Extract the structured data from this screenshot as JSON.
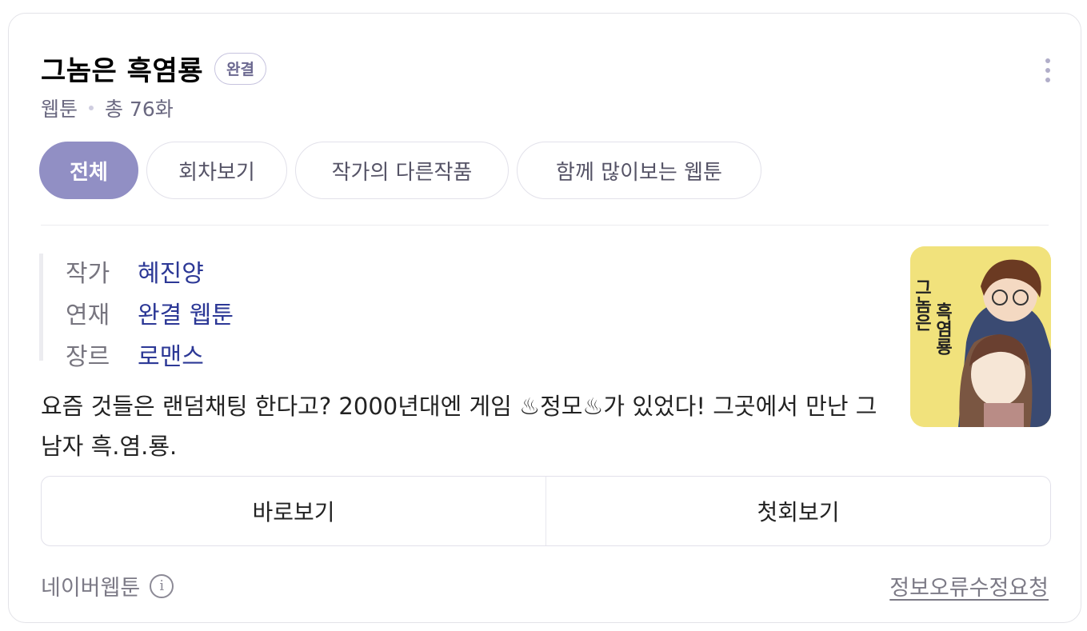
{
  "header": {
    "title": "그놈은 흑염룡",
    "status_badge": "완결",
    "meta_type": "웹툰",
    "meta_count": "총 76화"
  },
  "tabs": [
    {
      "label": "전체",
      "active": true
    },
    {
      "label": "회차보기",
      "active": false
    },
    {
      "label": "작가의 다른작품",
      "active": false
    },
    {
      "label": "함께 많이보는 웹툰",
      "active": false
    }
  ],
  "info": [
    {
      "label": "작가",
      "value": "혜진양"
    },
    {
      "label": "연재",
      "value": "완결 웹툰"
    },
    {
      "label": "장르",
      "value": "로맨스"
    }
  ],
  "synopsis": "요즘 것들은 랜덤채팅 한다고? 2000년대엔 게임 ♨정모♨가 있었다! 그곳에서 만난 그 남자 흑.염.룡.",
  "thumbnail": {
    "cover_text": "그놈은 흑염룡",
    "background_color": "#f1e27c"
  },
  "actions": {
    "read_now": "바로보기",
    "first_episode": "첫회보기"
  },
  "footer": {
    "source": "네이버웹툰",
    "report": "정보오류수정요청"
  },
  "colors": {
    "accent": "#918fc4",
    "link": "#2c3896"
  }
}
